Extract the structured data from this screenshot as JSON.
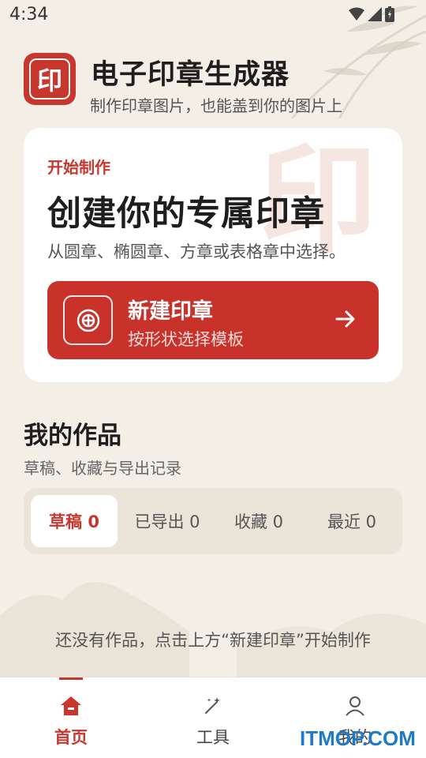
{
  "status_bar": {
    "time": "4:34"
  },
  "header": {
    "logo_char": "印",
    "title": "电子印章生成器",
    "subtitle": "制作印章图片，也能盖到你的图片上"
  },
  "create_card": {
    "kicker": "开始制作",
    "heading": "创建你的专属印章",
    "description": "从圆章、椭圆章、方章或表格章中选择。",
    "watermark_char": "印",
    "button": {
      "title": "新建印章",
      "subtitle": "按形状选择模板"
    }
  },
  "works": {
    "title": "我的作品",
    "subtitle": "草稿、收藏与导出记录",
    "tabs": [
      {
        "label": "草稿 0",
        "active": true
      },
      {
        "label": "已导出 0",
        "active": false
      },
      {
        "label": "收藏 0",
        "active": false
      },
      {
        "label": "最近 0",
        "active": false
      }
    ],
    "empty_text": "还没有作品，点击上方“新建印章”开始制作"
  },
  "bottom_nav": [
    {
      "label": "首页",
      "icon": "home-icon",
      "active": true
    },
    {
      "label": "工具",
      "icon": "magic-wand-icon",
      "active": false
    },
    {
      "label": "我的",
      "icon": "person-icon",
      "active": false
    }
  ],
  "watermark": "ITMOP.COM",
  "colors": {
    "accent": "#c8372d",
    "background": "#f4efe6",
    "card": "#ffffff"
  }
}
